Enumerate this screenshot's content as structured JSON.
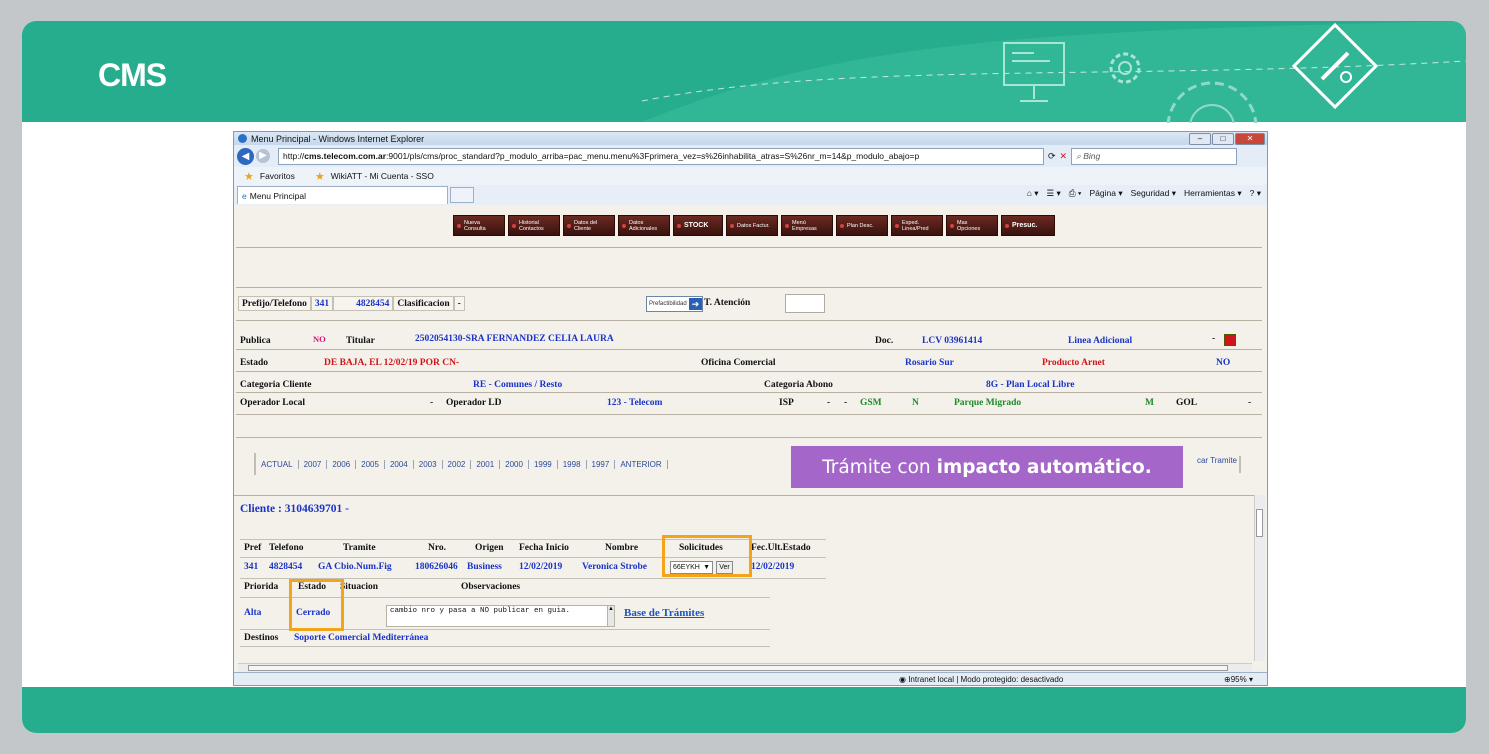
{
  "slide": {
    "brand": "CMS",
    "colors": {
      "band": "#26ad8d",
      "highlight": "#f4a41a",
      "callout": "#a467c9"
    },
    "callout_prefix": "Trámite con",
    "callout_bold": "impacto automático."
  },
  "browser": {
    "title": "Menu Principal - Windows Internet Explorer",
    "url_prefix": "http://",
    "url_host": "cms.telecom.com.ar",
    "url_rest": ":9001/pls/cms/proc_standard?p_modulo_arriba=pac_menu.menu%3Fprimera_vez=s%26inhabilita_atras=S%26nr_m=14&p_modulo_abajo=p",
    "search_placeholder": "Bing",
    "favorites_label": "Favoritos",
    "favorite_item": "WikiATT - Mi Cuenta - SSO",
    "tab_label": "Menu Principal",
    "cmd_pagina": "Página ▾",
    "cmd_seguridad": "Seguridad ▾",
    "cmd_herramientas": "Herramientas ▾",
    "status_zone": "Intranet local | Modo protegido: desactivado",
    "status_zoom": "95%"
  },
  "toolbar": {
    "buttons": [
      "Nueva Consulta",
      "Historial Contactos",
      "Datos del Cliente",
      "Datos Adicionales",
      "STOCK",
      "Datos Factur.",
      "Menú Empresas",
      "Plan Desc.",
      "Exped. Linea/Pred",
      "Mas Opciones",
      "Presuc."
    ]
  },
  "header": {
    "prefijo_label": "Prefijo/Telefono",
    "prefijo": "341",
    "telefono": "4828454",
    "clasificacion_label": "Clasificacion",
    "clasificacion_value": "-",
    "prefact_btn": "Prefactibilidad",
    "atencion_label": "T. Atención"
  },
  "info": {
    "publica_label": "Publica",
    "publica_value": "NO",
    "titular_label": "Titular",
    "titular_value": "2502054130-SRA FERNANDEZ CELIA LAURA",
    "doc_label": "Doc.",
    "doc_value": "LCV 03961414",
    "linea_adicional": "Linea Adicional",
    "dash": "-",
    "estado_label": "Estado",
    "estado_value": "DE BAJA, EL 12/02/19 POR CN-",
    "oficina_label": "Oficina Comercial",
    "oficina_value": "Rosario Sur",
    "producto_label": "Producto Arnet",
    "producto_value": "NO",
    "cat_cliente_label": "Categoria Cliente",
    "cat_cliente_value": "RE - Comunes / Resto",
    "cat_abono_label": "Categoria Abono",
    "cat_abono_value": "8G - Plan Local Libre",
    "op_local_label": "Operador Local",
    "op_local_value": "-",
    "op_ld_label": "Operador LD",
    "op_ld_value": "123 - Telecom",
    "isp_label": "ISP",
    "isp_v1": "-",
    "isp_v2": "-",
    "gsm": "GSM",
    "gsm_v": "N",
    "parque": "Parque Migrado",
    "parque_v": "M",
    "gol": "GOL",
    "gol_v": "-"
  },
  "years": [
    "ACTUAL",
    "2007",
    "2006",
    "2005",
    "2004",
    "2003",
    "2002",
    "2001",
    "2000",
    "1999",
    "1998",
    "1997",
    "ANTERIOR"
  ],
  "tramite_link": "car Tramite",
  "tramite": {
    "cliente": "Cliente : 3104639701 -",
    "headers": [
      "Pref",
      "Telefono",
      "Tramite",
      "Nro.",
      "Origen",
      "Fecha Inicio",
      "Nombre",
      "Solicitudes",
      "Fec.Ult.Estado"
    ],
    "pref": "341",
    "telefono": "4828454",
    "tramite": "GA Cbio.Num.Fig",
    "nro": "180626046",
    "origen": "Business",
    "fecha_inicio": "12/02/2019",
    "nombre": "Veronica Strobe",
    "solicitud": "66EYKH",
    "ver_btn": "Ver",
    "fec_ult": "12/02/2019",
    "h2_prioridad": "Priorida",
    "h2_estado": "Estado",
    "h2_situacion": "Situacion",
    "h2_observaciones": "Observaciones",
    "prioridad": "Alta",
    "estado": "Cerrado",
    "observaciones": "cambio nro y pasa a NO publicar en guia.",
    "base_link": "Base de Trámites",
    "destinos_label": "Destinos",
    "destinos_value": "Soporte Comercial Mediterránea"
  }
}
